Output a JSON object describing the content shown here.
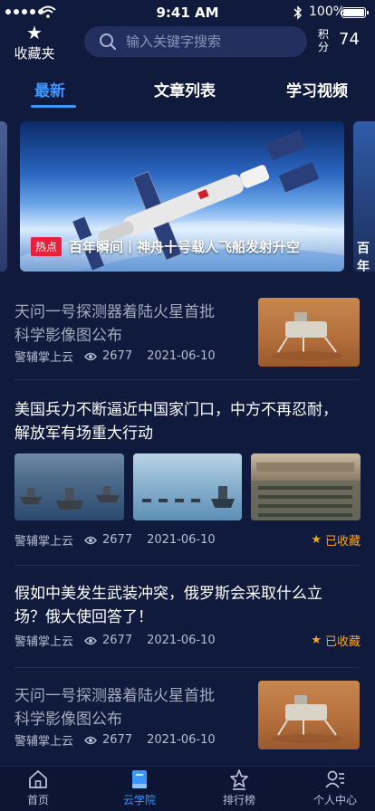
{
  "status_bar": {
    "time": "9:41 AM",
    "battery": "100%"
  },
  "header": {
    "favorites_label": "收藏夹",
    "search_placeholder": "输入关键字搜索",
    "points_label": "积分",
    "points_value": "74"
  },
  "tabs": [
    {
      "label": "最新",
      "active": true
    },
    {
      "label": "文章列表",
      "active": false
    },
    {
      "label": "学习视频",
      "active": false
    }
  ],
  "banner": {
    "badge": "热点",
    "title": "百年瞬间丨神舟十号载人飞船发射升空",
    "next_peek": "百年"
  },
  "articles": [
    {
      "title_line1": "天问一号探测器着陆火星首批",
      "title_line2": "科学影像图公布",
      "source": "警辅掌上云",
      "views": "2677",
      "date": "2021-06-10",
      "read": true
    },
    {
      "title_line1": "美国兵力不断逼近中国家门口，中方不再忍耐，",
      "title_line2": "解放军有场重大行动",
      "source": "警辅掌上云",
      "views": "2677",
      "date": "2021-06-10",
      "collected": "已收藏"
    },
    {
      "title_line1": "假如中美发生武装冲突，俄罗斯会采取什么立",
      "title_line2": "场？俄大使回答了！",
      "source": "警辅掌上云",
      "views": "2677",
      "date": "2021-06-10",
      "collected": "已收藏"
    },
    {
      "title_line1": "天问一号探测器着陆火星首批",
      "title_line2": "科学影像图公布",
      "source": "警辅掌上云",
      "views": "2677",
      "date": "2021-06-10",
      "read": true
    }
  ],
  "bottom_nav": [
    {
      "label": "首页",
      "icon": "home-icon",
      "active": false
    },
    {
      "label": "云学院",
      "icon": "book-icon",
      "active": true
    },
    {
      "label": "排行榜",
      "icon": "ranking-star-icon",
      "active": false
    },
    {
      "label": "个人中心",
      "icon": "profile-icon",
      "active": false
    }
  ],
  "colors": {
    "background": "#0f1a3c",
    "accent": "#3e96ff",
    "hot": "#e8203c",
    "collected": "#f5a623"
  }
}
